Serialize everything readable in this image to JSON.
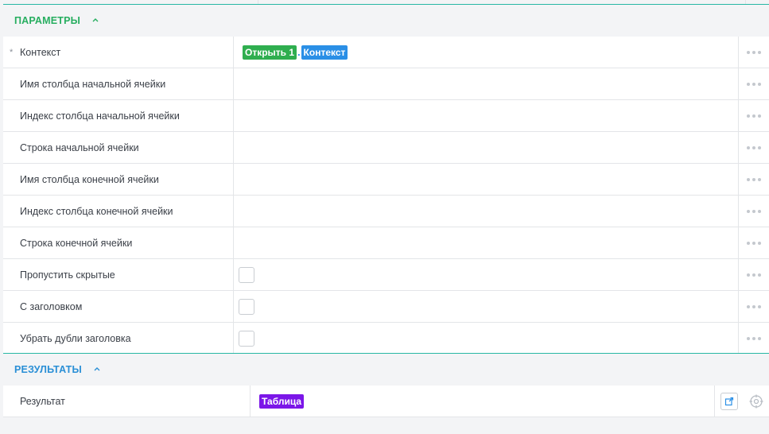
{
  "parameters": {
    "title": "ПАРАМЕТРЫ",
    "rows": [
      {
        "label": "Контекст",
        "required_mark": "*"
      },
      {
        "label": "Имя столбца начальной ячейки"
      },
      {
        "label": "Индекс столбца начальной ячейки"
      },
      {
        "label": "Строка начальной ячейки"
      },
      {
        "label": "Имя столбца конечной ячейки"
      },
      {
        "label": "Индекс столбца конечной ячейки"
      },
      {
        "label": "Строка конечной ячейки"
      },
      {
        "label": "Пропустить скрытые",
        "checked": false
      },
      {
        "label": "С заголовком",
        "checked": false
      },
      {
        "label": "Убрать дубли заголовка",
        "checked": false
      }
    ],
    "context_value": {
      "source_chip": "Открыть 1",
      "separator": ".",
      "property_chip": "Контекст"
    }
  },
  "results": {
    "title": "РЕЗУЛЬТАТЫ",
    "rows": [
      {
        "label": "Результат",
        "value_chip": "Таблица"
      }
    ]
  },
  "colors": {
    "accent_teal": "#27b7a4",
    "params_title": "#27ae60",
    "results_title": "#2a8fd6",
    "chip_green": "#2fae4f",
    "chip_blue": "#2a8fe6",
    "chip_purple": "#7b16e8"
  },
  "icons": {
    "collapse": "chevron-up-icon",
    "more": "more-dots-icon",
    "export": "export-icon",
    "target": "crosshair-icon"
  }
}
